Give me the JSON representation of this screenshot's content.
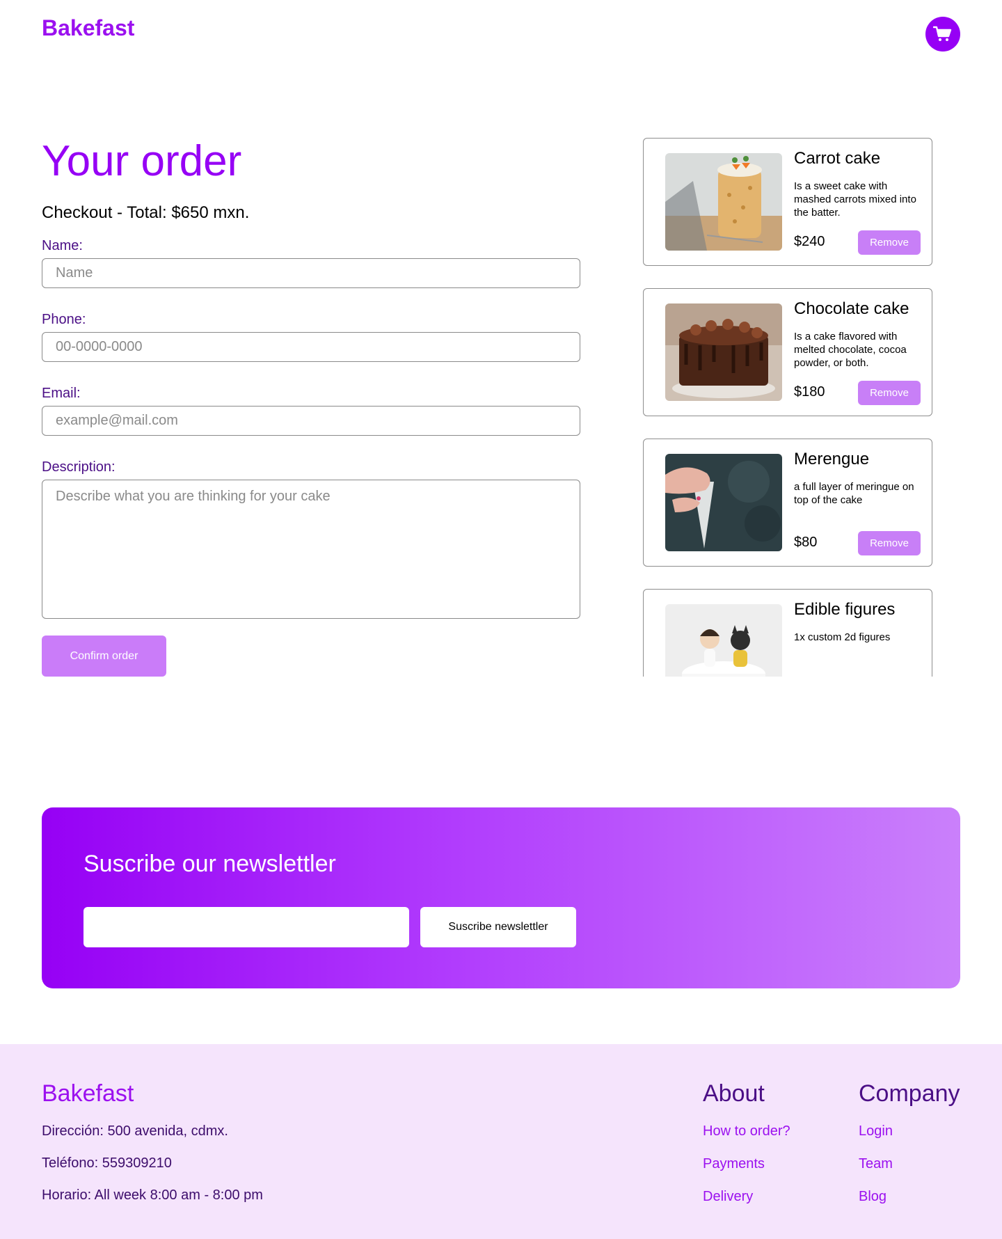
{
  "header": {
    "brand": "Bakefast"
  },
  "order": {
    "title": "Your order",
    "checkout": "Checkout - Total: $650 mxn.",
    "fields": {
      "name_label": "Name:",
      "name_placeholder": "Name",
      "phone_label": "Phone:",
      "phone_placeholder": "00-0000-0000",
      "email_label": "Email:",
      "email_placeholder": "example@mail.com",
      "description_label": "Description:",
      "description_placeholder": "Describe what you are thinking for your cake"
    },
    "confirm_label": "Confirm order"
  },
  "cart": {
    "items": [
      {
        "name": "Carrot cake",
        "description": "Is a sweet cake with mashed carrots mixed into the batter.",
        "price": "$240",
        "remove_label": "Remove"
      },
      {
        "name": "Chocolate cake",
        "description": "Is a cake flavored with melted chocolate, cocoa powder, or both.",
        "price": "$180",
        "remove_label": "Remove"
      },
      {
        "name": "Merengue",
        "description": "a full layer of meringue on top of the cake",
        "price": "$80",
        "remove_label": "Remove"
      },
      {
        "name": "Edible figures",
        "description": "1x custom 2d figures"
      }
    ]
  },
  "newsletter": {
    "title": "Suscribe our newslettler",
    "input_value": "",
    "button_label": "Suscribe newslettler"
  },
  "footer": {
    "brand": "Bakefast",
    "address": "Dirección: 500 avenida, cdmx.",
    "phone": "Teléfono: 559309210",
    "hours": "Horario: All week 8:00 am - 8:00 pm",
    "about": {
      "title": "About",
      "links": [
        "How to order?",
        "Payments",
        "Delivery"
      ]
    },
    "company": {
      "title": "Company",
      "links": [
        "Login",
        "Team",
        "Blog"
      ]
    }
  },
  "colors": {
    "brand_purple": "#9600f5",
    "button_light_purple": "#ca7cf9",
    "footer_bg": "#f5e4fc"
  },
  "icons": {
    "cart": "shopping-cart-icon"
  }
}
